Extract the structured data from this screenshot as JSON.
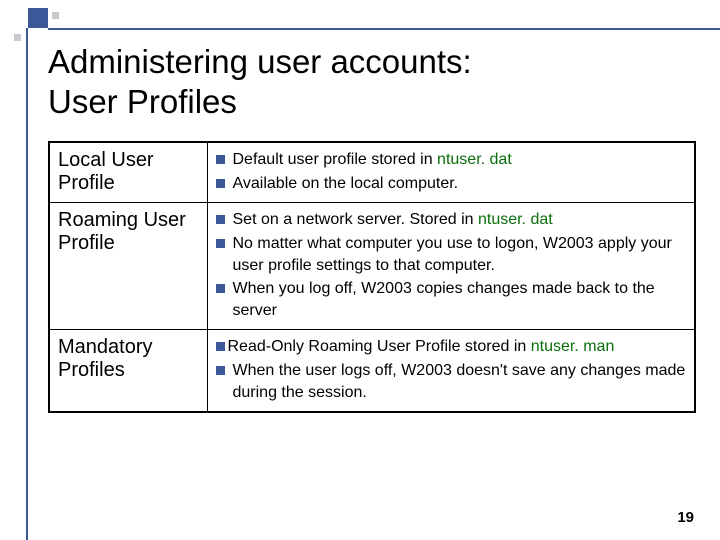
{
  "title_line1": "Administering user accounts:",
  "title_line2": "User Profiles",
  "rows": [
    {
      "label": "Local User Profile",
      "bullets": [
        {
          "pre": "Default user profile stored in ",
          "file": "ntuser. dat",
          "post": ""
        },
        {
          "pre": "Available on the local computer.",
          "file": "",
          "post": ""
        }
      ]
    },
    {
      "label": "Roaming User Profile",
      "bullets": [
        {
          "pre": "Set on a network server. Stored in ",
          "file": "ntuser. dat",
          "post": ""
        },
        {
          "pre": "No matter what computer you use to logon, W2003 apply your user profile settings to that computer.",
          "file": "",
          "post": ""
        },
        {
          "pre": "When you log off, W2003 copies changes made back to the server",
          "file": "",
          "post": ""
        }
      ]
    },
    {
      "label": "Mandatory Profiles",
      "bullets": [
        {
          "pre": "Read-Only Roaming User Profile stored in ",
          "file": "ntuser. man",
          "post": ""
        },
        {
          "pre": "When the user logs off, W2003 doesn't save any changes made during the session.",
          "file": "",
          "post": ""
        }
      ]
    }
  ],
  "page_number": "19"
}
